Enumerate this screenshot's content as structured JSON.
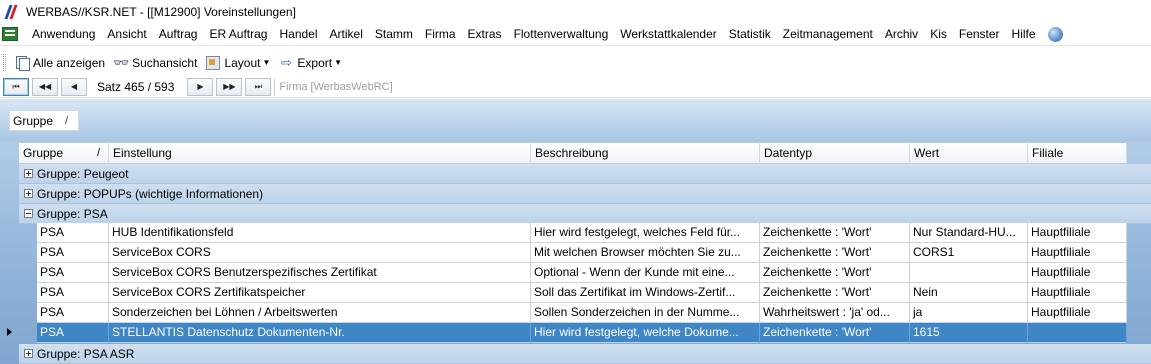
{
  "window": {
    "title": "WERBAS//KSR.NET - [[M12900] Voreinstellungen]"
  },
  "menu": {
    "items": [
      "Anwendung",
      "Ansicht",
      "Auftrag",
      "ER Auftrag",
      "Handel",
      "Artikel",
      "Stamm",
      "Firma",
      "Extras",
      "Flottenverwaltung",
      "Werkstattkalender",
      "Statistik",
      "Zeitmanagement",
      "Archiv",
      "Kis",
      "Fenster",
      "Hilfe"
    ]
  },
  "toolbar": {
    "show_all": "Alle anzeigen",
    "search_view": "Suchansicht",
    "layout": "Layout",
    "export": "Export"
  },
  "navigator": {
    "record_position": "Satz 465 / 593",
    "firma_placeholder": "Firma [WerbasWebRC]",
    "first": "⏮",
    "prev_page": "◀◀",
    "prev": "◀",
    "next": "▶",
    "next_page": "▶▶",
    "last": "⏭"
  },
  "group_panel": {
    "chip_label": "Gruppe",
    "chip_sort": "/"
  },
  "grid": {
    "columns": [
      "Gruppe",
      "Einstellung",
      "Beschreibung",
      "Datentyp",
      "Wert",
      "Filiale"
    ],
    "header_sort_mark": "/",
    "groups": [
      {
        "label": "Gruppe: Peugeot"
      },
      {
        "label": "Gruppe: POPUPs (wichtige Informationen)"
      },
      {
        "label": "Gruppe: PSA"
      },
      {
        "label": "Gruppe: PSA ASR"
      }
    ],
    "rows": [
      {
        "gruppe": "PSA",
        "einstellung": "HUB Identifikationsfeld",
        "beschreibung": "Hier wird festgelegt, welches Feld für...",
        "datentyp": "Zeichenkette : 'Wort'",
        "wert": "Nur Standard-HU...",
        "filiale": "Hauptfiliale"
      },
      {
        "gruppe": "PSA",
        "einstellung": "ServiceBox CORS",
        "beschreibung": "Mit welchen Browser möchten Sie zu...",
        "datentyp": "Zeichenkette : 'Wort'",
        "wert": "CORS1",
        "filiale": "Hauptfiliale"
      },
      {
        "gruppe": "PSA",
        "einstellung": "ServiceBox CORS Benutzerspezifisches Zertifikat",
        "beschreibung": "Optional - Wenn der Kunde mit eine...",
        "datentyp": "Zeichenkette : 'Wort'",
        "wert": "",
        "filiale": "Hauptfiliale"
      },
      {
        "gruppe": "PSA",
        "einstellung": "ServiceBox CORS Zertifikatspeicher",
        "beschreibung": "Soll das Zertifikat im Windows-Zertif...",
        "datentyp": "Zeichenkette : 'Wort'",
        "wert": "Nein",
        "filiale": "Hauptfiliale"
      },
      {
        "gruppe": "PSA",
        "einstellung": "Sonderzeichen bei Löhnen / Arbeitswerten",
        "beschreibung": "Sollen Sonderzeichen in der Numme...",
        "datentyp": "Wahrheitswert : 'ja' od...",
        "wert": "ja",
        "filiale": "Hauptfiliale"
      },
      {
        "gruppe": "PSA",
        "einstellung": "STELLANTIS Datenschutz Dokumenten-Nr.",
        "beschreibung": "Hier wird festgelegt, welche Dokume...",
        "datentyp": "Zeichenkette : 'Wort'",
        "wert": "1615",
        "filiale": ""
      }
    ]
  }
}
